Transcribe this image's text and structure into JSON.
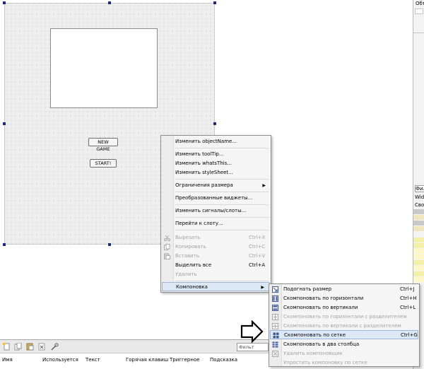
{
  "form": {
    "buttons": {
      "new_game": "NEW GAME",
      "start": "START!"
    }
  },
  "context_menu": {
    "items": [
      {
        "label": "Изменить objectName...",
        "shortcut": "",
        "disabled": false,
        "submenu": false
      },
      {
        "label": "Изменить toolTip...",
        "shortcut": "",
        "disabled": false,
        "submenu": false
      },
      {
        "label": "Изменить whatsThis...",
        "shortcut": "",
        "disabled": false,
        "submenu": false
      },
      {
        "label": "Изменить styleSheet...",
        "shortcut": "",
        "disabled": false,
        "submenu": false
      },
      {
        "label": "Ограничения размера",
        "shortcut": "",
        "disabled": false,
        "submenu": true
      },
      {
        "label": "Преобразованные виджеты...",
        "shortcut": "",
        "disabled": false,
        "submenu": false
      },
      {
        "label": "Изменить сигналы/слоты...",
        "shortcut": "",
        "disabled": false,
        "submenu": false
      },
      {
        "label": "Перейти к слоту...",
        "shortcut": "",
        "disabled": false,
        "submenu": false
      },
      {
        "label": "Вырезать",
        "shortcut": "Ctrl+X",
        "disabled": true,
        "submenu": false
      },
      {
        "label": "Копировать",
        "shortcut": "Ctrl+C",
        "disabled": true,
        "submenu": false
      },
      {
        "label": "Вставить",
        "shortcut": "Ctrl+V",
        "disabled": true,
        "submenu": false
      },
      {
        "label": "Выделить все",
        "shortcut": "Ctrl+A",
        "disabled": false,
        "submenu": false
      },
      {
        "label": "Удалить",
        "shortcut": "",
        "disabled": true,
        "submenu": false
      },
      {
        "label": "Компоновка",
        "shortcut": "",
        "disabled": false,
        "submenu": true
      }
    ]
  },
  "layout_submenu": {
    "items": [
      {
        "label": "Подогнать размер",
        "shortcut": "Ctrl+J",
        "disabled": false
      },
      {
        "label": "Скомпоновать по горизонтали",
        "shortcut": "Ctrl+H",
        "disabled": false
      },
      {
        "label": "Скомпоновать по вертикали",
        "shortcut": "Ctrl+L",
        "disabled": false
      },
      {
        "label": "Скомпоновать по горизонтали с разделителем",
        "shortcut": "",
        "disabled": true
      },
      {
        "label": "Скомпоновать по вертикали с разделителем",
        "shortcut": "",
        "disabled": true
      },
      {
        "label": "Скомпоновать по сетке",
        "shortcut": "Ctrl+G",
        "disabled": false
      },
      {
        "label": "Скомпоновать в два столбца",
        "shortcut": "",
        "disabled": false
      },
      {
        "label": "Удалить компоновщик",
        "shortcut": "",
        "disabled": true
      },
      {
        "label": "Упростить компоновку по сетке",
        "shortcut": "",
        "disabled": true
      }
    ]
  },
  "bottom_panel": {
    "filter_placeholder": "Фильт",
    "columns": [
      "Имя",
      "Используется",
      "Текст",
      "Горячая клавиш",
      "Триггерное",
      "Подсказка"
    ]
  },
  "right_panel": {
    "object_title": "Объ",
    "filter_text": "Фильт",
    "widget_label": "Widg",
    "props_label": "Свой"
  }
}
